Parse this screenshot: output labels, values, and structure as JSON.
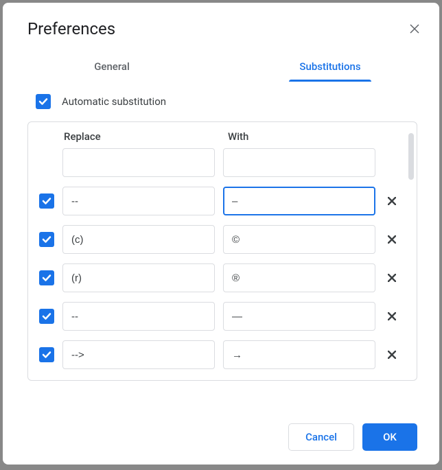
{
  "dialog": {
    "title": "Preferences"
  },
  "tabs": {
    "general": "General",
    "substitutions": "Substitutions"
  },
  "auto_sub": {
    "label": "Automatic substitution",
    "checked": true
  },
  "columns": {
    "replace": "Replace",
    "with": "With"
  },
  "rows": [
    {
      "checked": null,
      "replace": "",
      "with": "",
      "deletable": false,
      "focused": false
    },
    {
      "checked": true,
      "replace": "--",
      "with": "–",
      "deletable": true,
      "focused": true
    },
    {
      "checked": true,
      "replace": "(c)",
      "with": "©",
      "deletable": true,
      "focused": false
    },
    {
      "checked": true,
      "replace": "(r)",
      "with": "®",
      "deletable": true,
      "focused": false
    },
    {
      "checked": true,
      "replace": "--",
      "with": "—",
      "deletable": true,
      "focused": false
    },
    {
      "checked": true,
      "replace": "-->",
      "with": "→",
      "deletable": true,
      "focused": false
    }
  ],
  "footer": {
    "cancel": "Cancel",
    "ok": "OK"
  }
}
